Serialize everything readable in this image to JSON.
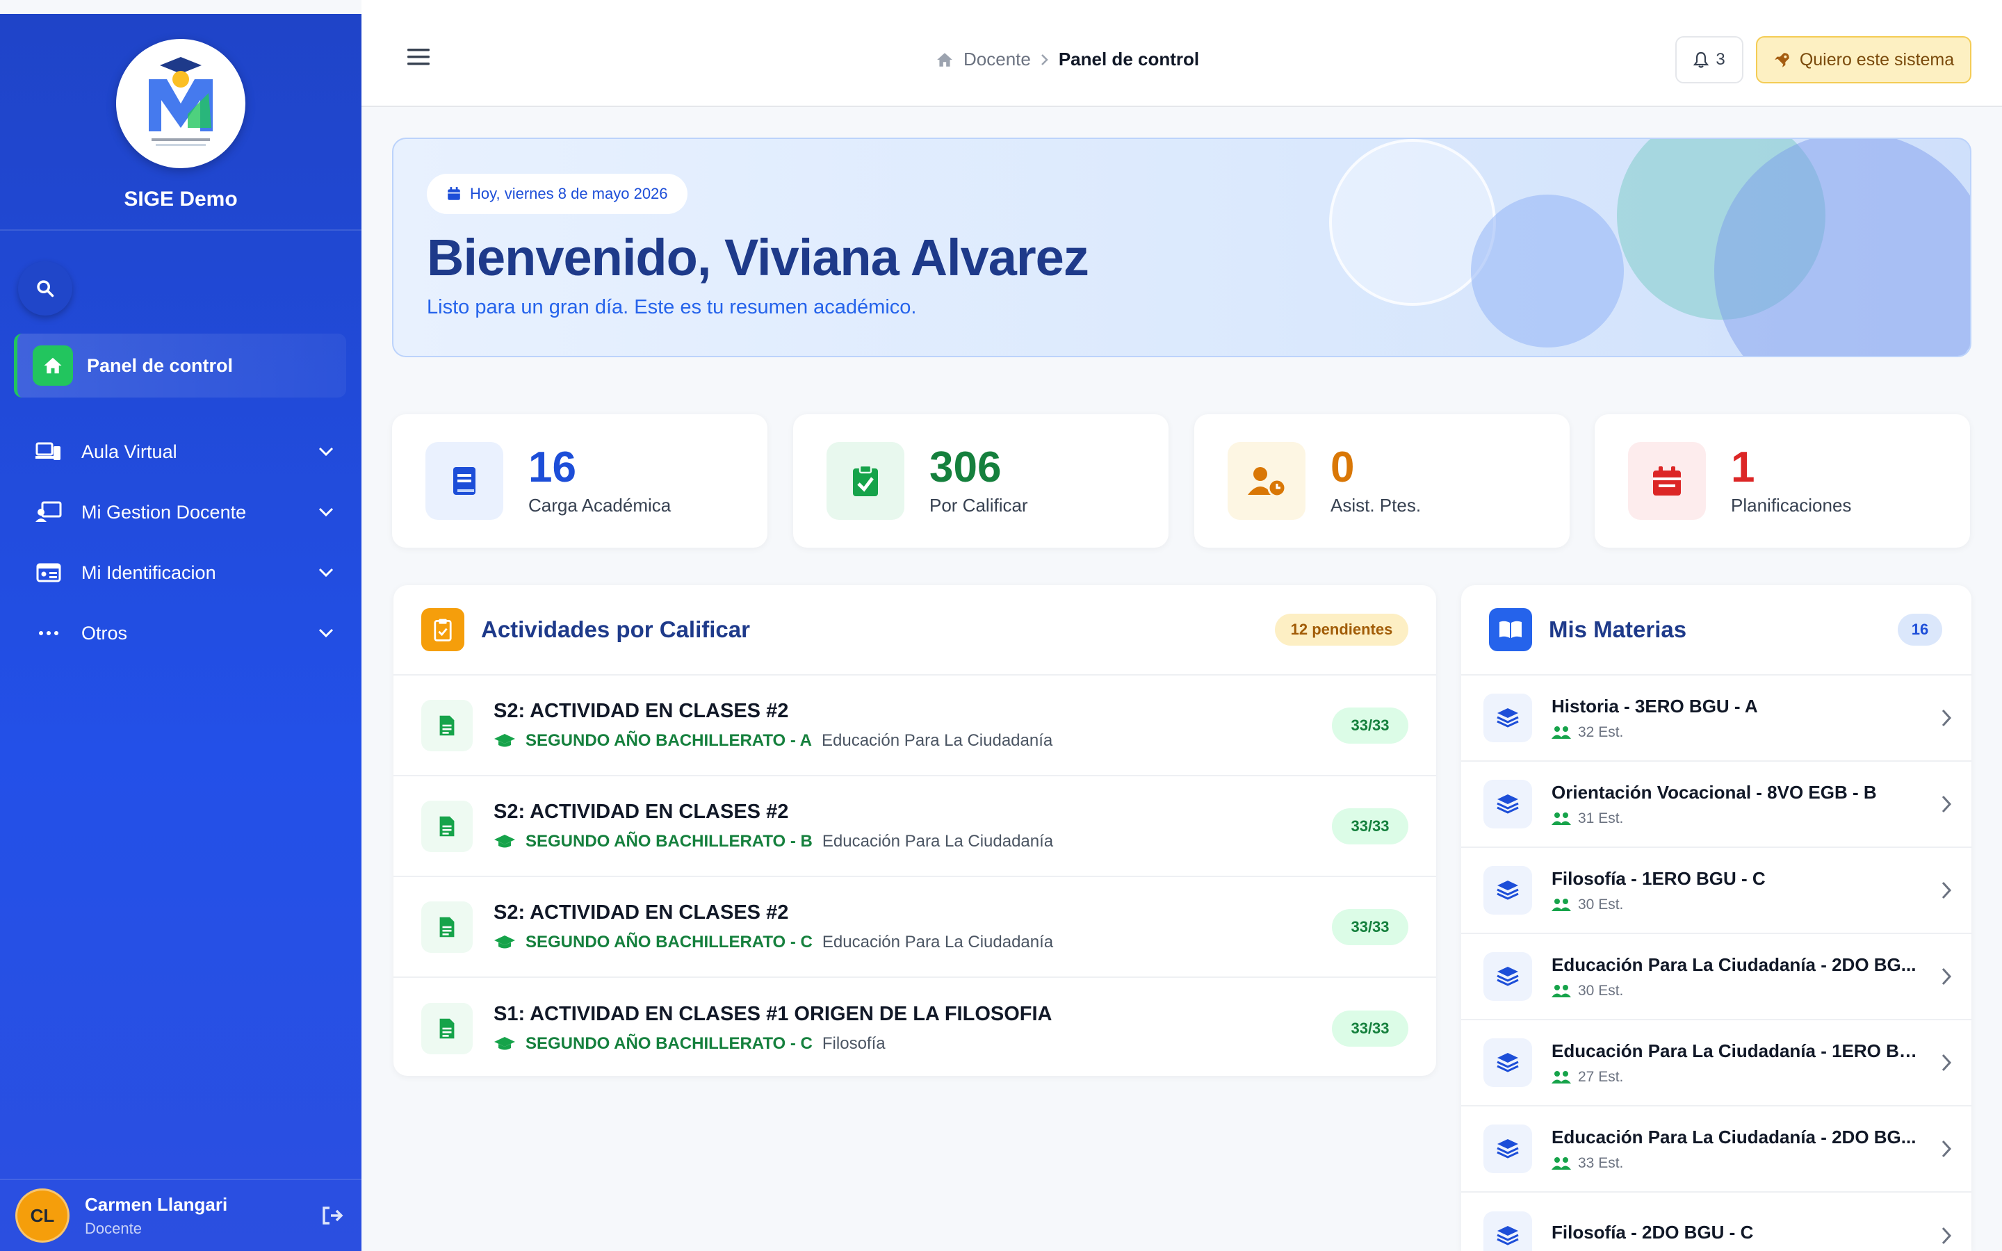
{
  "sidebar": {
    "brand": "SIGE Demo",
    "active_item": "Panel de control",
    "items": [
      {
        "label": "Aula Virtual",
        "icon": "laptop-icon"
      },
      {
        "label": "Mi Gestion Docente",
        "icon": "teacher-board-icon"
      },
      {
        "label": "Mi Identificacion",
        "icon": "id-card-icon"
      },
      {
        "label": "Otros",
        "icon": "ellipsis-icon"
      }
    ],
    "user": {
      "initials": "CL",
      "name": "Carmen Llangari",
      "role": "Docente"
    }
  },
  "topbar": {
    "breadcrumb_root": "Docente",
    "breadcrumb_current": "Panel de control",
    "notifications": "3",
    "cta_label": "Quiero este sistema"
  },
  "hero": {
    "date": "Hoy, viernes 8 de mayo 2026",
    "title": "Bienvenido, Viviana Alvarez",
    "subtitle": "Listo para un gran día. Este es tu resumen académico."
  },
  "stats": [
    {
      "value": "16",
      "label": "Carga Académica",
      "color": "#1d4ed8"
    },
    {
      "value": "306",
      "label": "Por Calificar",
      "color": "#15803d"
    },
    {
      "value": "0",
      "label": "Asist. Ptes.",
      "color": "#d97706"
    },
    {
      "value": "1",
      "label": "Planificaciones",
      "color": "#dc2626"
    }
  ],
  "activities": {
    "title": "Actividades por Calificar",
    "badge": "12 pendientes",
    "rows": [
      {
        "title": "S2: ACTIVIDAD EN CLASES #2",
        "grade": "SEGUNDO AÑO BACHILLERATO - A",
        "subject": "Educación Para La Ciudadanía",
        "count": "33/33"
      },
      {
        "title": "S2: ACTIVIDAD EN CLASES #2",
        "grade": "SEGUNDO AÑO BACHILLERATO - B",
        "subject": "Educación Para La Ciudadanía",
        "count": "33/33"
      },
      {
        "title": "S2: ACTIVIDAD EN CLASES #2",
        "grade": "SEGUNDO AÑO BACHILLERATO - C",
        "subject": "Educación Para La Ciudadanía",
        "count": "33/33"
      },
      {
        "title": "S1: ACTIVIDAD EN CLASES #1 ORIGEN DE LA FILOSOFIA",
        "grade": "SEGUNDO AÑO BACHILLERATO - C",
        "subject": "Filosofía",
        "count": "33/33"
      }
    ]
  },
  "subjects": {
    "title": "Mis Materias",
    "badge": "16",
    "rows": [
      {
        "name": "Historia - 3ERO BGU - A",
        "students": "32 Est."
      },
      {
        "name": "Orientación Vocacional - 8VO EGB - B",
        "students": "31 Est."
      },
      {
        "name": "Filosofía - 1ERO BGU - C",
        "students": "30 Est."
      },
      {
        "name": "Educación Para La Ciudadanía - 2DO BG...",
        "students": "30 Est."
      },
      {
        "name": "Educación Para La Ciudadanía - 1ERO BG...",
        "students": "27 Est."
      },
      {
        "name": "Educación Para La Ciudadanía - 2DO BG...",
        "students": "33 Est."
      },
      {
        "name": "Filosofía - 2DO BGU - C",
        "students": ""
      }
    ]
  }
}
